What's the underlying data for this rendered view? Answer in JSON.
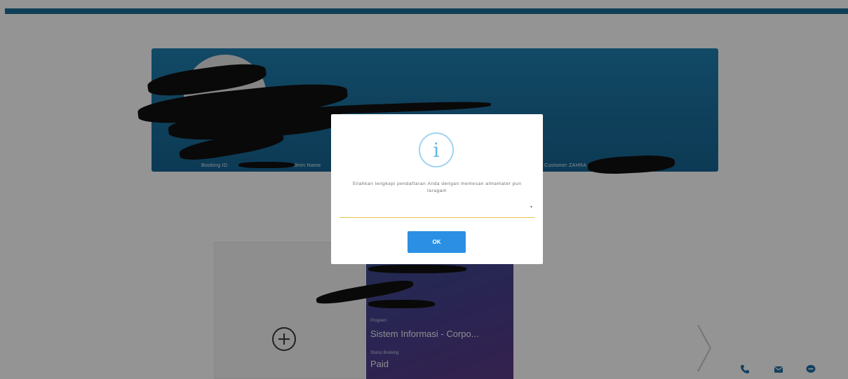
{
  "header": {
    "accent_color": "#1c6e96"
  },
  "profile": {
    "info_fields": [
      "Booking ID",
      "Admin Name",
      "Customer ZAHRA"
    ]
  },
  "cards": {
    "add_card": {
      "icon": "plus-circle-icon"
    },
    "program_card": {
      "program_label": "Program",
      "program_value": "Sistem Informasi - Corpo...",
      "status_label": "Status Booking",
      "status_value": "Paid"
    }
  },
  "navigation": {
    "next_icon": "chevron-right-icon"
  },
  "contacts": {
    "icons": [
      "phone-icon",
      "email-icon",
      "chat-icon"
    ]
  },
  "modal": {
    "icon": "info-icon",
    "icon_glyph": "i",
    "message": "Silahkan lengkapi pendaftaran Anda dengan memesan almamater pun taragam",
    "select_value": "",
    "ok_label": "OK"
  }
}
